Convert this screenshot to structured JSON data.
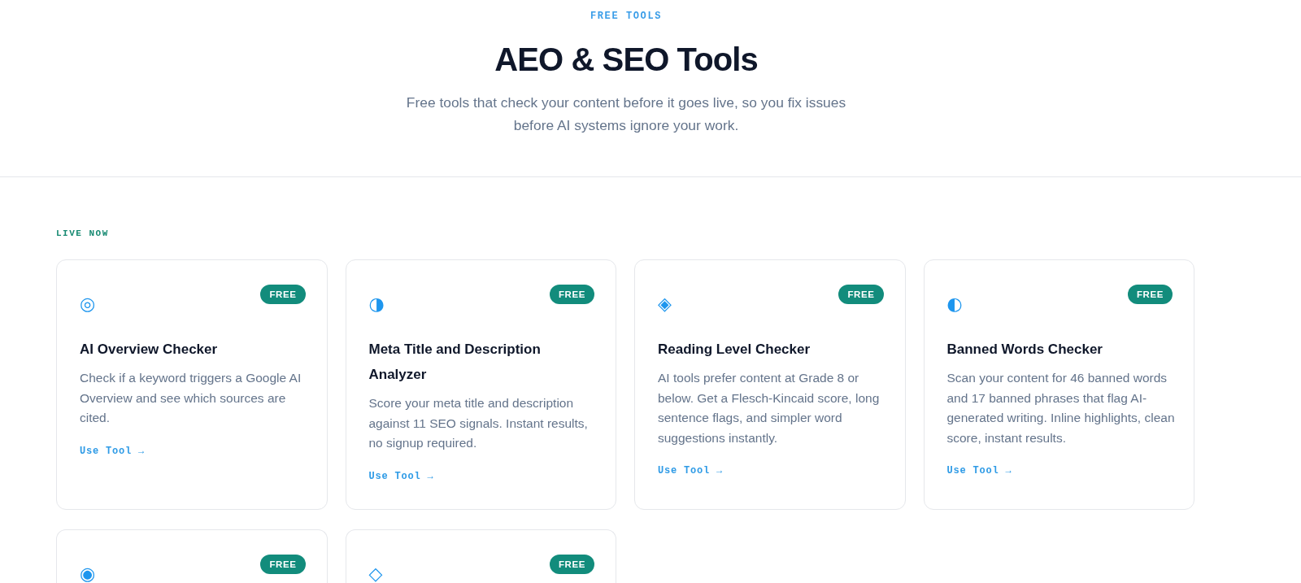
{
  "header": {
    "eyebrow": "FREE TOOLS",
    "title": "AEO & SEO Tools",
    "subtitle": "Free tools that check your content before it goes live, so you fix issues before AI systems ignore your work."
  },
  "section": {
    "label": "LIVE NOW",
    "cards": [
      {
        "icon": "◎",
        "badge": "FREE",
        "title": "AI Overview Checker",
        "description": "Check if a keyword triggers a Google AI Overview and see which sources are cited.",
        "link": "Use Tool →"
      },
      {
        "icon": "◑",
        "badge": "FREE",
        "title": "Meta Title and Description Analyzer",
        "description": "Score your meta title and description against 11 SEO signals. Instant results, no signup required.",
        "link": "Use Tool →"
      },
      {
        "icon": "◈",
        "badge": "FREE",
        "title": "Reading Level Checker",
        "description": "AI tools prefer content at Grade 8 or below. Get a Flesch-Kincaid score, long sentence flags, and simpler word suggestions instantly.",
        "link": "Use Tool →"
      },
      {
        "icon": "◐",
        "badge": "FREE",
        "title": "Banned Words Checker",
        "description": "Scan your content for 46 banned words and 17 banned phrases that flag AI-generated writing. Inline highlights, clean score, instant results.",
        "link": "Use Tool →"
      },
      {
        "icon": "◉",
        "badge": "FREE"
      },
      {
        "icon": "◇",
        "badge": "FREE"
      }
    ]
  }
}
